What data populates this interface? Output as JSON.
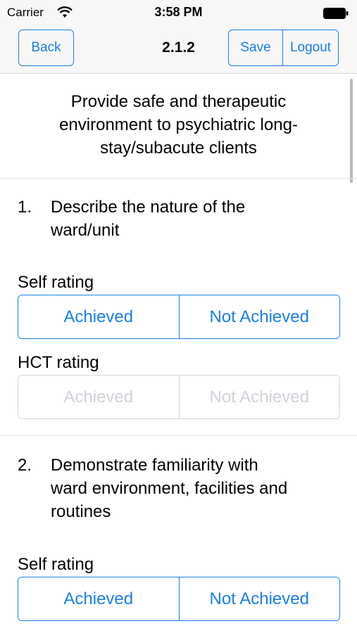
{
  "status": {
    "carrier": "Carrier",
    "time": "3:58 PM",
    "icons": [
      "wifi-icon",
      "battery-icon"
    ]
  },
  "nav": {
    "back_label": "Back",
    "title": "2.1.2",
    "save_label": "Save",
    "logout_label": "Logout"
  },
  "section": {
    "title_lines": [
      "Provide safe and therapeutic",
      "environment to psychiatric long-",
      "stay/subacute clients"
    ]
  },
  "questions": [
    {
      "number": "1.",
      "text_lines": [
        "Describe the nature of the",
        "ward/unit"
      ],
      "self_rating_label": "Self rating",
      "self_options": [
        "Achieved",
        "Not Achieved"
      ],
      "hct_rating_label": "HCT rating",
      "hct_options": [
        "Achieved",
        "Not Achieved"
      ]
    },
    {
      "number": "2.",
      "text_lines": [
        "Demonstrate familiarity with",
        "ward environment, facilities and",
        "routines"
      ],
      "self_rating_label": "Self rating",
      "self_options": [
        "Achieved",
        "Not Achieved"
      ]
    }
  ],
  "colors": {
    "accent": "#1a7ee6",
    "disabled_border": "#cfd6de",
    "disabled_text": "#cfd3d8",
    "bar_background": "#f7f7f7"
  }
}
